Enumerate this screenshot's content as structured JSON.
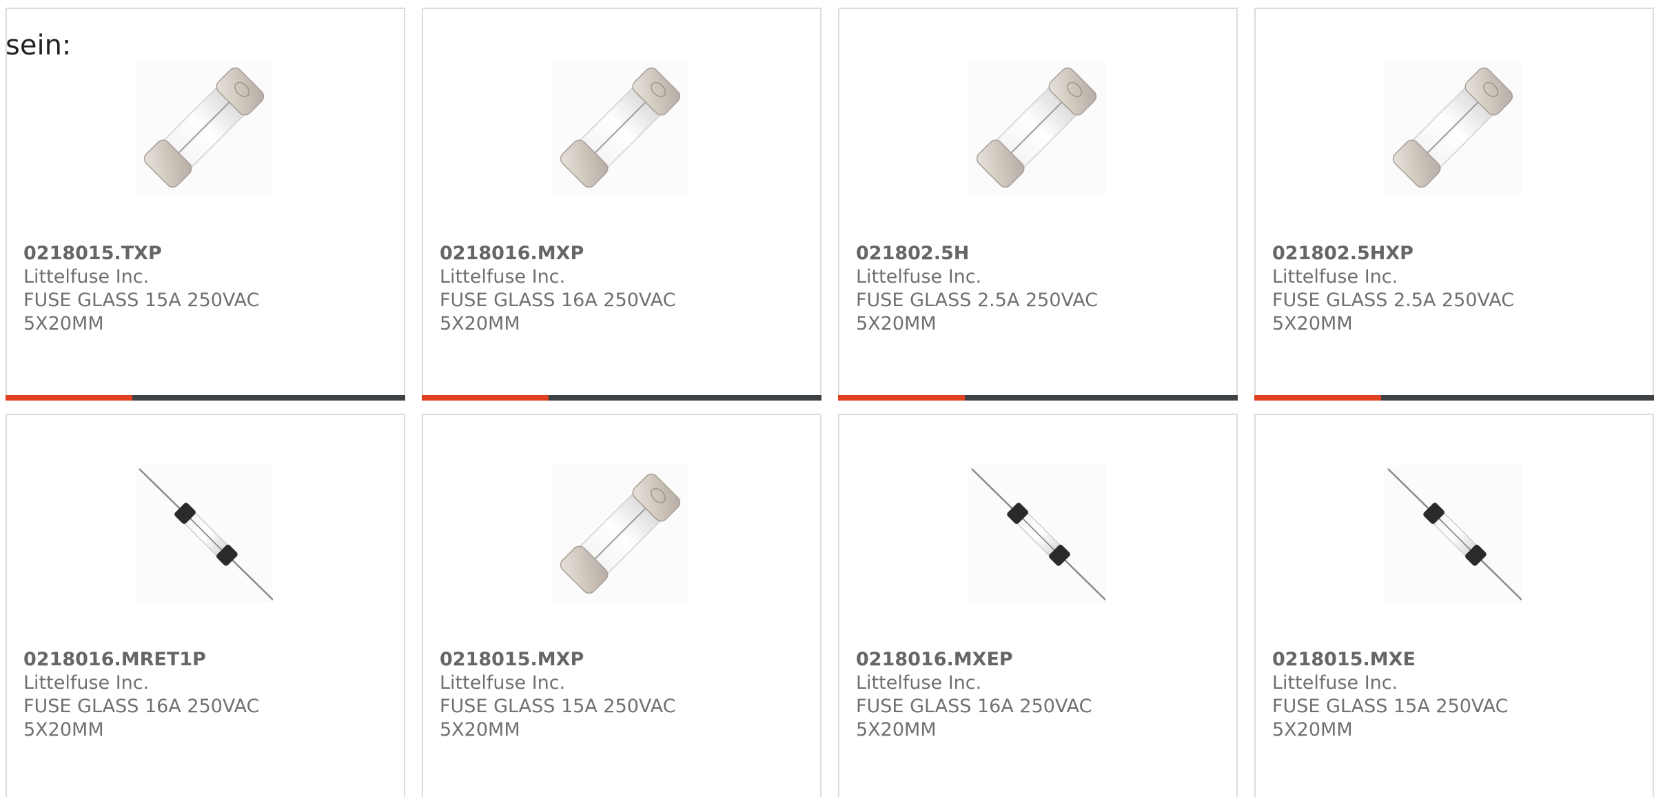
{
  "intro_text": "sein:",
  "accent_color": "#e0401f",
  "bar_color": "#3f4245",
  "products": [
    {
      "part_number": "0218015.TXP",
      "manufacturer": "Littelfuse Inc.",
      "description": "FUSE GLASS 15A 250VAC 5X20MM",
      "image": "cartridge-fuse-icon"
    },
    {
      "part_number": "0218016.MXP",
      "manufacturer": "Littelfuse Inc.",
      "description": "FUSE GLASS 16A 250VAC 5X20MM",
      "image": "cartridge-fuse-icon"
    },
    {
      "part_number": "021802.5H",
      "manufacturer": "Littelfuse Inc.",
      "description": "FUSE GLASS 2.5A 250VAC 5X20MM",
      "image": "cartridge-fuse-icon"
    },
    {
      "part_number": "021802.5HXP",
      "manufacturer": "Littelfuse Inc.",
      "description": "FUSE GLASS 2.5A 250VAC 5X20MM",
      "image": "cartridge-fuse-icon"
    },
    {
      "part_number": "0218016.MRET1P",
      "manufacturer": "Littelfuse Inc.",
      "description": "FUSE GLASS 16A 250VAC 5X20MM",
      "image": "axial-lead-fuse-icon"
    },
    {
      "part_number": "0218015.MXP",
      "manufacturer": "Littelfuse Inc.",
      "description": "FUSE GLASS 15A 250VAC 5X20MM",
      "image": "cartridge-fuse-icon"
    },
    {
      "part_number": "0218016.MXEP",
      "manufacturer": "Littelfuse Inc.",
      "description": "FUSE GLASS 16A 250VAC 5X20MM",
      "image": "axial-lead-fuse-icon"
    },
    {
      "part_number": "0218015.MXE",
      "manufacturer": "Littelfuse Inc.",
      "description": "FUSE GLASS 15A 250VAC 5X20MM",
      "image": "axial-lead-fuse-icon"
    }
  ]
}
